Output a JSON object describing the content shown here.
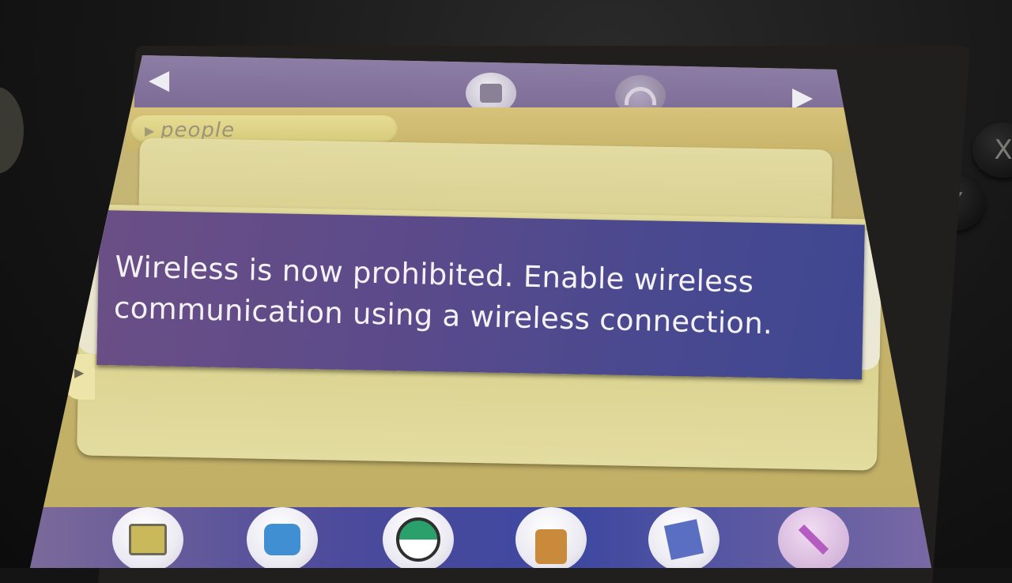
{
  "top_bar": {
    "left_arrow": "◀",
    "right_arrow": "▶",
    "icons": [
      "notes-icon",
      "wifi-icon"
    ]
  },
  "tabs": {
    "people_label": "people"
  },
  "dialog": {
    "message_line1": "Wireless is now prohibited. Enable wireless",
    "message_line2": "communication using a wireless connection."
  },
  "bottom_bar": {
    "icons": [
      "profile-card-icon",
      "trade-icon",
      "pokeball-icon",
      "bag-icon",
      "pokedex-icon",
      "settings-icon"
    ]
  },
  "hardware_buttons": {
    "x_label": "X",
    "y_label": "Y"
  },
  "colors": {
    "banner": "#4a4990",
    "bar": "#7b6a94",
    "card": "#ded695"
  }
}
